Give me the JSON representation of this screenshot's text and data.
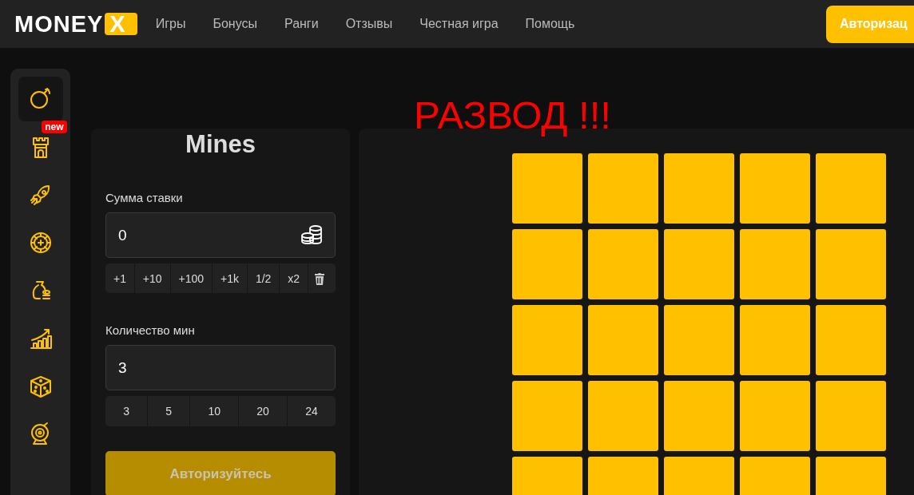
{
  "header": {
    "logo": {
      "text": "MONEY",
      "mark": "X"
    },
    "nav": [
      {
        "label": "Игры"
      },
      {
        "label": "Бонусы"
      },
      {
        "label": "Ранги"
      },
      {
        "label": "Отзывы"
      },
      {
        "label": "Честная игра"
      },
      {
        "label": "Помощь"
      }
    ],
    "login_button": "Авторизац"
  },
  "sidebar": {
    "items": [
      {
        "kind": "bomb",
        "selected": true
      },
      {
        "kind": "tower",
        "selected": false,
        "badge": "new"
      },
      {
        "kind": "rocket",
        "selected": false
      },
      {
        "kind": "wheel",
        "selected": false
      },
      {
        "kind": "bag",
        "selected": false
      },
      {
        "kind": "chart",
        "selected": false
      },
      {
        "kind": "dice",
        "selected": false
      },
      {
        "kind": "target",
        "selected": false
      }
    ]
  },
  "annotation": "РАЗВОД !!!",
  "game": {
    "title": "Mines",
    "bet": {
      "label": "Сумма ставки",
      "value": "0",
      "quick": [
        {
          "kind": "text",
          "label": "+1"
        },
        {
          "kind": "text",
          "label": "+10"
        },
        {
          "kind": "text",
          "label": "+100"
        },
        {
          "kind": "text",
          "label": "+1k"
        },
        {
          "kind": "text",
          "label": "1/2"
        },
        {
          "kind": "text",
          "label": "x2"
        },
        {
          "kind": "trash"
        }
      ]
    },
    "mines": {
      "label": "Количество мин",
      "value": "3",
      "quick": [
        {
          "label": "3"
        },
        {
          "label": "5"
        },
        {
          "label": "10"
        },
        {
          "label": "20"
        },
        {
          "label": "24"
        }
      ]
    },
    "action_button": {
      "label": "Авторизуйтесь",
      "disabled": true
    }
  },
  "board": {
    "tiles": [
      {
        "revealed": false
      },
      {
        "revealed": false
      },
      {
        "revealed": false
      },
      {
        "revealed": false
      },
      {
        "revealed": false
      },
      {
        "revealed": false
      },
      {
        "revealed": false
      },
      {
        "revealed": false
      },
      {
        "revealed": false
      },
      {
        "revealed": false
      },
      {
        "revealed": false
      },
      {
        "revealed": false
      },
      {
        "revealed": false
      },
      {
        "revealed": false
      },
      {
        "revealed": false
      },
      {
        "revealed": false
      },
      {
        "revealed": false
      },
      {
        "revealed": false
      },
      {
        "revealed": false
      },
      {
        "revealed": false
      },
      {
        "revealed": false
      },
      {
        "revealed": false
      },
      {
        "revealed": false
      },
      {
        "revealed": false
      },
      {
        "revealed": false
      }
    ]
  }
}
